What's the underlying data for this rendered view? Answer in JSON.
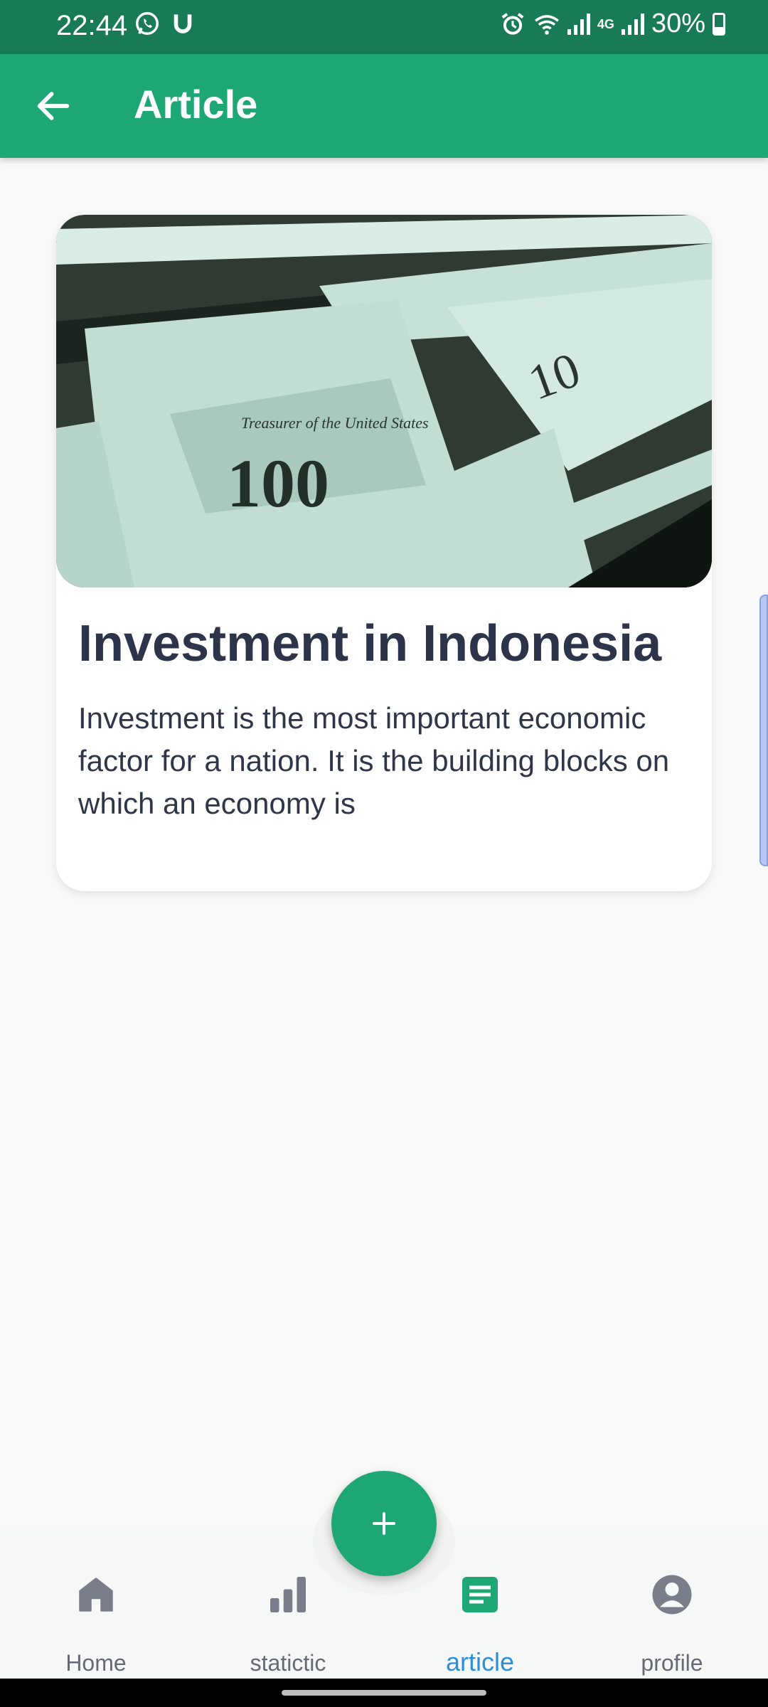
{
  "status_bar": {
    "time": "22:44",
    "battery": "30%",
    "network": "4G"
  },
  "app_bar": {
    "title": "Article"
  },
  "article_card": {
    "title": "Investment in Indonesia",
    "excerpt": "Investment is the most important economic factor for a nation. It is the building blocks on which an economy is"
  },
  "bottom_nav": {
    "items": [
      {
        "label": "Home",
        "icon": "home-icon",
        "active": false
      },
      {
        "label": "statictic",
        "icon": "bar-chart-icon",
        "active": false
      },
      {
        "label": "article",
        "icon": "article-icon",
        "active": true
      },
      {
        "label": "profile",
        "icon": "profile-icon",
        "active": false
      }
    ]
  },
  "fab": {
    "icon": "plus-icon"
  },
  "colors": {
    "status_bar": "#187b56",
    "app_bar": "#1da774",
    "active_nav": "#2e8fd8",
    "inactive_nav": "#666a75",
    "title_text": "#2d3348"
  }
}
